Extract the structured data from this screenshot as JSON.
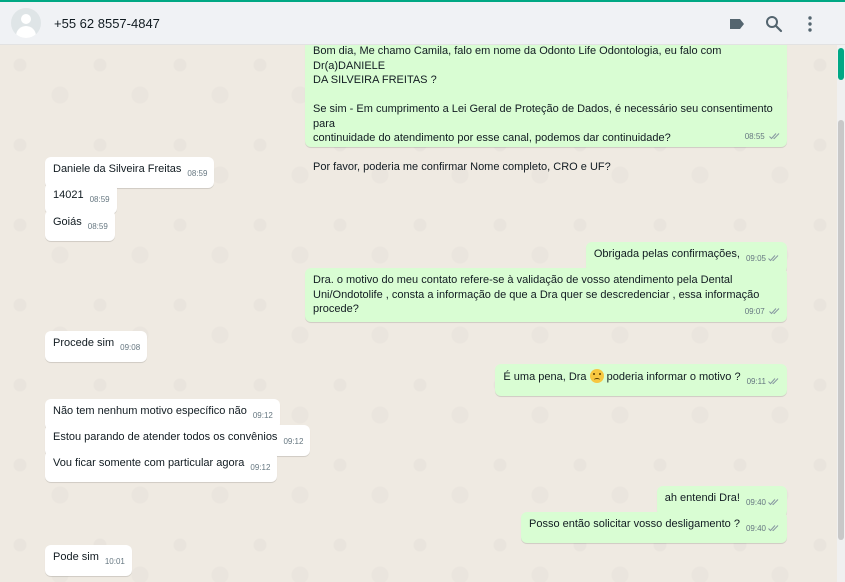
{
  "header": {
    "contact": "+55 62 8557-4847",
    "icons": [
      "label-icon",
      "search-icon",
      "menu-icon"
    ]
  },
  "colors": {
    "accent": "#00a884",
    "outgoing": "#d9fdd3",
    "incoming": "#ffffff"
  },
  "messages": [
    {
      "dir": "out",
      "lines": [
        "Bom dia, Me chamo Camila, falo em nome da Odonto Life Odontologia, eu falo com Dr(a)DANIELE",
        "DA SILVEIRA FREITAS ?",
        "",
        "Se sim - Em cumprimento a Lei Geral de Proteção de Dados, é necessário seu consentimento para",
        "continuidade do atendimento por esse canal, podemos dar continuidade?",
        "",
        "Por favor, poderia me confirmar Nome completo, CRO e UF?"
      ],
      "time": "08:55"
    },
    {
      "dir": "in",
      "text": "Daniele da Silveira Freitas",
      "time": "08:59"
    },
    {
      "dir": "in",
      "text": "14021",
      "time": "08:59"
    },
    {
      "dir": "in",
      "text": "Goiás",
      "time": "08:59"
    },
    {
      "dir": "out",
      "text": "Obrigada pelas confirmações,",
      "time": "09:05"
    },
    {
      "dir": "out",
      "lines": [
        "Dra. o motivo do meu contato refere-se à validação de vosso atendimento pela Dental",
        "Uni/Ondotolife , consta a informação de que a Dra quer se descredenciar , essa informação",
        "procede?"
      ],
      "time": "09:07"
    },
    {
      "dir": "in",
      "text": "Procede sim",
      "time": "09:08"
    },
    {
      "dir": "out",
      "text_before": "É uma pena, Dra",
      "text_after": " poderia informar o motivo ?",
      "time": "09:11"
    },
    {
      "dir": "in",
      "text": "Não tem nenhum motivo específico não",
      "time": "09:12"
    },
    {
      "dir": "in",
      "text": "Estou parando de atender todos os convênios",
      "time": "09:12"
    },
    {
      "dir": "in",
      "text": "Vou ficar somente com particular agora",
      "time": "09:12"
    },
    {
      "dir": "out",
      "text": "ah entendi Dra!",
      "time": "09:40"
    },
    {
      "dir": "out",
      "text": "Posso então solicitar vosso desligamento ?",
      "time": "09:40"
    },
    {
      "dir": "in",
      "text": "Pode sim",
      "time": "10:01"
    }
  ]
}
